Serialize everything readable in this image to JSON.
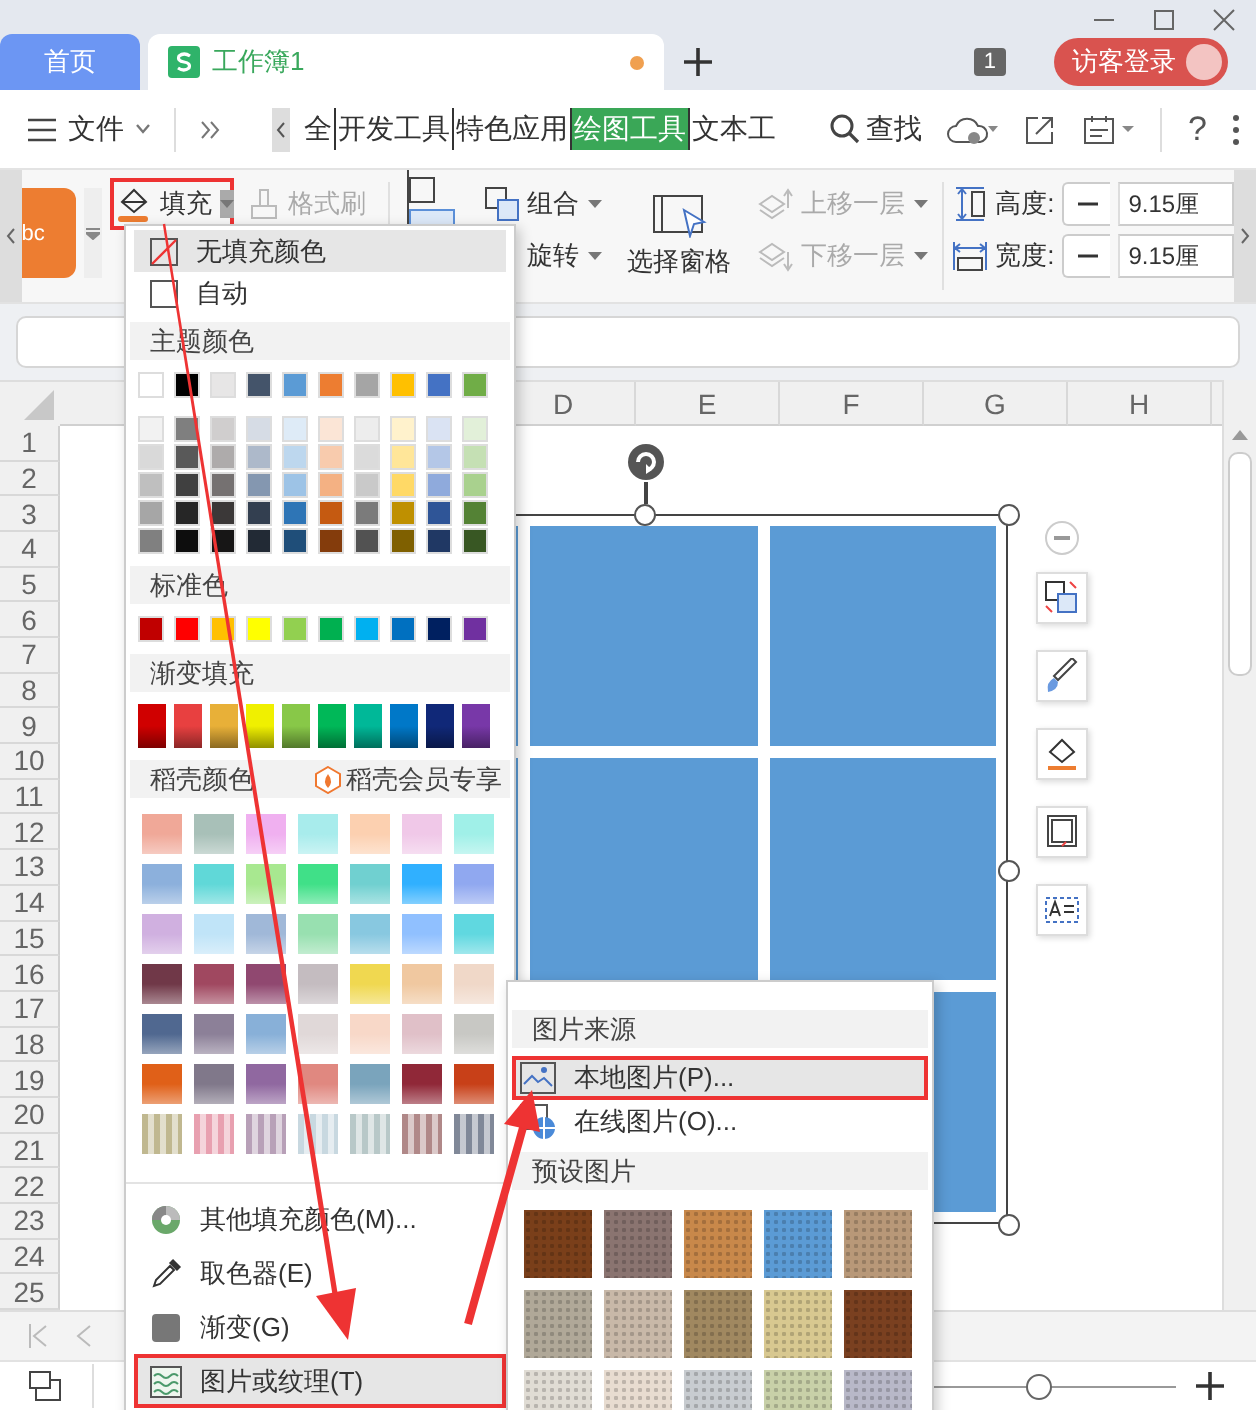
{
  "tabs": [
    {
      "label": "首页",
      "kind": "home",
      "selected": false,
      "unsaved": false
    },
    {
      "label": "工作簿1",
      "kind": "document",
      "selected": true,
      "unsaved": true
    }
  ],
  "tab_count": "1",
  "login": "访客登录",
  "menu": {
    "file": "文件",
    "ribbon_tabs": [
      {
        "label": "全",
        "selected": false
      },
      {
        "label": "开发工具",
        "selected": false
      },
      {
        "label": "特色应用",
        "selected": false
      },
      {
        "label": "绘图工具",
        "selected": true
      },
      {
        "label": "文本工",
        "selected": false
      }
    ],
    "search": "查找",
    "help": "?"
  },
  "ribbon": {
    "style_preview": "bc",
    "fill": {
      "label": "填充",
      "highlighted": true
    },
    "format_painter": {
      "label": "格式刷",
      "disabled": true
    },
    "group": "组合",
    "rotate": "旋转",
    "selection_pane": "选择窗格",
    "bring_forward": {
      "label": "上移一层",
      "disabled": true
    },
    "send_backward": {
      "label": "下移一层",
      "disabled": true
    },
    "height": {
      "label": "高度:",
      "value": "9.15厘"
    },
    "width": {
      "label": "宽度:",
      "value": "9.15厘"
    }
  },
  "sheet": {
    "columns": [
      "D",
      "E",
      "F",
      "G",
      "H"
    ],
    "rows": [
      "1",
      "2",
      "3",
      "4",
      "5",
      "6",
      "7",
      "8",
      "9",
      "10",
      "11",
      "12",
      "13",
      "14",
      "15",
      "16",
      "17",
      "18",
      "19",
      "20",
      "21",
      "22",
      "23",
      "24",
      "25"
    ]
  },
  "zoom": {
    "level": 0.5
  },
  "fill_menu": {
    "items_top": [
      {
        "label": "无填充颜色",
        "kind": "none",
        "hovered": true
      },
      {
        "label": "自动",
        "kind": "auto",
        "hovered": false
      }
    ],
    "theme_header": "主题颜色",
    "theme_colors": [
      {
        "color": "#ffffff"
      },
      {
        "color": "#000000"
      },
      {
        "color": "#e7e6e6"
      },
      {
        "color": "#44546a"
      },
      {
        "color": "#5b9bd5"
      },
      {
        "color": "#ed7d31"
      },
      {
        "color": "#a5a5a5"
      },
      {
        "color": "#ffc000"
      },
      {
        "color": "#4472c4"
      },
      {
        "color": "#70ad47"
      }
    ],
    "theme_shades": [
      {
        "color": "#f2f2f2"
      },
      {
        "color": "#7f7f7f"
      },
      {
        "color": "#d0cece"
      },
      {
        "color": "#d6dce5"
      },
      {
        "color": "#deebf7"
      },
      {
        "color": "#fbe5d6"
      },
      {
        "color": "#ededed"
      },
      {
        "color": "#fff2cc"
      },
      {
        "color": "#dae3f3"
      },
      {
        "color": "#e2f0d9"
      },
      {
        "color": "#d9d9d9"
      },
      {
        "color": "#595959"
      },
      {
        "color": "#aeabab"
      },
      {
        "color": "#adb9ca"
      },
      {
        "color": "#bdd7ee"
      },
      {
        "color": "#f8cbad"
      },
      {
        "color": "#dbdbdb"
      },
      {
        "color": "#ffe699"
      },
      {
        "color": "#b4c7e7"
      },
      {
        "color": "#c5e0b4"
      },
      {
        "color": "#bfbfbf"
      },
      {
        "color": "#404040"
      },
      {
        "color": "#757171"
      },
      {
        "color": "#8497b0"
      },
      {
        "color": "#9dc3e6"
      },
      {
        "color": "#f4b183"
      },
      {
        "color": "#c9c9c9"
      },
      {
        "color": "#ffd966"
      },
      {
        "color": "#8faadc"
      },
      {
        "color": "#a9d18e"
      },
      {
        "color": "#a6a6a6"
      },
      {
        "color": "#262626"
      },
      {
        "color": "#3b3838"
      },
      {
        "color": "#333f50"
      },
      {
        "color": "#2e75b6"
      },
      {
        "color": "#c55a11"
      },
      {
        "color": "#7b7b7b"
      },
      {
        "color": "#bf9000"
      },
      {
        "color": "#2f5597"
      },
      {
        "color": "#548235"
      },
      {
        "color": "#808080"
      },
      {
        "color": "#0d0d0d"
      },
      {
        "color": "#171616"
      },
      {
        "color": "#222a35"
      },
      {
        "color": "#1f4e79"
      },
      {
        "color": "#843c0c"
      },
      {
        "color": "#525252"
      },
      {
        "color": "#7f6000"
      },
      {
        "color": "#203864"
      },
      {
        "color": "#385723"
      }
    ],
    "standard_header": "标准色",
    "standard_colors": [
      {
        "color": "#c00000"
      },
      {
        "color": "#ff0000"
      },
      {
        "color": "#ffc000"
      },
      {
        "color": "#ffff00"
      },
      {
        "color": "#92d050"
      },
      {
        "color": "#00b050"
      },
      {
        "color": "#00b0f0"
      },
      {
        "color": "#0070c0"
      },
      {
        "color": "#002060"
      },
      {
        "color": "#7030a0"
      }
    ],
    "gradient_header": "渐变填充",
    "gradients": [
      {
        "color": "#d00000"
      },
      {
        "color": "#e84040"
      },
      {
        "color": "#e8b038"
      },
      {
        "color": "#f0f000"
      },
      {
        "color": "#88c848"
      },
      {
        "color": "#00b858"
      },
      {
        "color": "#00b898"
      },
      {
        "color": "#0078c8"
      },
      {
        "color": "#102878"
      },
      {
        "color": "#7838a8"
      }
    ],
    "docer_header": "稻壳颜色",
    "docer_vip": "稻壳会员专享",
    "docer_gradients": [
      {
        "color": "#f0a898"
      },
      {
        "color": "#a8c0b8"
      },
      {
        "color": "#f0b0f0"
      },
      {
        "color": "#a8ecec"
      },
      {
        "color": "#fcd0b0"
      },
      {
        "color": "#f0c8e8"
      },
      {
        "color": "#a0f0e8"
      },
      {
        "color": "#8cb0dc"
      },
      {
        "color": "#60d8d8"
      },
      {
        "color": "#a8e890"
      },
      {
        "color": "#40e088"
      },
      {
        "color": "#70d0d0"
      },
      {
        "color": "#30b0ff"
      },
      {
        "color": "#90a8f0"
      },
      {
        "color": "#d0b0e0"
      },
      {
        "color": "#c0e4f8"
      },
      {
        "color": "#a0b8d8"
      },
      {
        "color": "#98e0b0"
      },
      {
        "color": "#88c8e0"
      },
      {
        "color": "#90c0ff"
      },
      {
        "color": "#60d8e0"
      },
      {
        "color": "#703848"
      },
      {
        "color": "#a04860"
      },
      {
        "color": "#904870"
      },
      {
        "color": "#c4bcc0"
      },
      {
        "color": "#f0d850"
      },
      {
        "color": "#f0c8a0"
      },
      {
        "color": "#f0d8c8"
      },
      {
        "color": "#506890"
      },
      {
        "color": "#8c8098"
      },
      {
        "color": "#88b0d8"
      },
      {
        "color": "#e0d8d8"
      },
      {
        "color": "#f8d8c8"
      },
      {
        "color": "#e0c0c8"
      },
      {
        "color": "#c8c8c4"
      },
      {
        "color": "#e06018"
      },
      {
        "color": "#80788a"
      },
      {
        "color": "#9068a0"
      },
      {
        "color": "#e08880"
      },
      {
        "color": "#7aa4bc"
      },
      {
        "color": "#902838"
      },
      {
        "color": "#c84018"
      },
      {
        "color": "#c0b890"
      },
      {
        "color": "#e8a0b0"
      },
      {
        "color": "#b8a0b8"
      },
      {
        "color": "#c8d8e0"
      },
      {
        "color": "#b8c8c8"
      },
      {
        "color": "#b08888"
      },
      {
        "color": "#808898"
      }
    ],
    "actions": [
      {
        "label": "其他填充颜色(M)...",
        "kind": "more-colors",
        "highlighted": false
      },
      {
        "label": "取色器(E)",
        "kind": "eyedropper",
        "highlighted": false
      },
      {
        "label": "渐变(G)",
        "kind": "gradient",
        "highlighted": false
      },
      {
        "label": "图片或纹理(T)",
        "kind": "texture",
        "highlighted": true
      }
    ]
  },
  "picture_submenu": {
    "source_header": "图片来源",
    "items": [
      {
        "label": "本地图片(P)...",
        "kind": "local",
        "hovered": true,
        "highlighted": true
      },
      {
        "label": "在线图片(O)...",
        "kind": "online",
        "hovered": false,
        "highlighted": false
      }
    ],
    "preset_header": "预设图片",
    "textures": [
      {
        "color": "#7a3f1a"
      },
      {
        "color": "#8a7470"
      },
      {
        "color": "#c8884a"
      },
      {
        "color": "#5b9bd5"
      },
      {
        "color": "#b89878"
      },
      {
        "color": "#b0a898"
      },
      {
        "color": "#c8b8a8"
      },
      {
        "color": "#a08860"
      },
      {
        "color": "#d8c890"
      },
      {
        "color": "#7a4020"
      },
      {
        "color": "#e0dcd4"
      },
      {
        "color": "#e8dcd0"
      },
      {
        "color": "#c8ccd0"
      },
      {
        "color": "#c8d0a8"
      },
      {
        "color": "#b8b8c8"
      }
    ]
  }
}
